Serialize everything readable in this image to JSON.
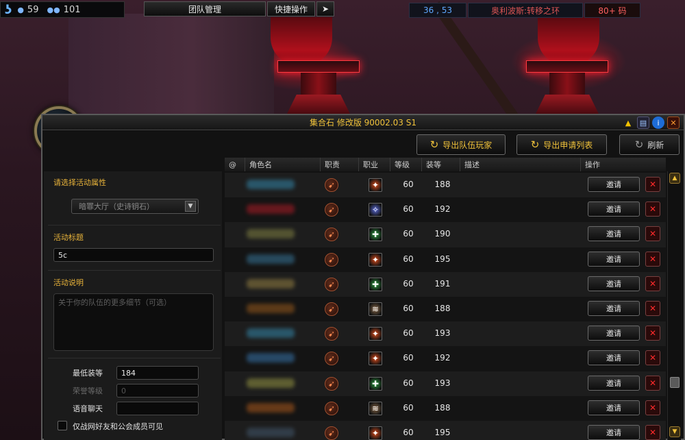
{
  "topbar": {
    "online_count": "59",
    "member_count": "101",
    "team_button": "团队管理",
    "quick_button": "快捷操作",
    "coords": "36 , 53",
    "zone": "奥利波斯:转移之环",
    "level_text": "80+ 码"
  },
  "window": {
    "title": "集合石 修改版 90002.03 S1",
    "export_team": "导出队伍玩家",
    "export_apply": "导出申请列表",
    "refresh": "刷新"
  },
  "left": {
    "activity_attr_label": "请选择活动属性",
    "activity_select_value": "暗罪大厅（史诗钥石）",
    "activity_title_label": "活动标题",
    "activity_title_value": "5c",
    "activity_desc_label": "活动说明",
    "activity_desc_placeholder": "关于你的队伍的更多细节（可选）",
    "min_ilvl_label": "最低装等",
    "min_ilvl_value": "184",
    "honor_label": "荣誉等级",
    "honor_value": "0",
    "voice_label": "语音聊天",
    "voice_value": "",
    "friends_only_label": "仅战网好友和公会成员可见"
  },
  "table": {
    "headers": {
      "at": "@",
      "name": "角色名",
      "role": "职责",
      "class": "职业",
      "level": "等级",
      "ilvl": "装等",
      "desc": "描述",
      "action": "操作"
    },
    "invite_label": "邀请",
    "reject_label": "✕",
    "rows": [
      {
        "level": "60",
        "ilvl": "188",
        "class_icon": "fire-class-icon",
        "class_color": "#d84a1a",
        "name_color": "#2f6f8a"
      },
      {
        "level": "60",
        "ilvl": "192",
        "class_icon": "frost-class-icon",
        "class_color": "#5a6ad8",
        "name_color": "#8a1a22"
      },
      {
        "level": "60",
        "ilvl": "190",
        "class_icon": "nature-class-icon",
        "class_color": "#2aa040",
        "name_color": "#6a6a3a"
      },
      {
        "level": "60",
        "ilvl": "195",
        "class_icon": "fire-class-icon",
        "class_color": "#d84a1a",
        "name_color": "#2f5f7a"
      },
      {
        "level": "60",
        "ilvl": "191",
        "class_icon": "nature-class-icon",
        "class_color": "#2aa040",
        "name_color": "#7a6a3a"
      },
      {
        "level": "60",
        "ilvl": "188",
        "class_icon": "claw-class-icon",
        "class_color": "#8a6a4a",
        "name_color": "#7a4a1a"
      },
      {
        "level": "60",
        "ilvl": "193",
        "class_icon": "fire-class-icon",
        "class_color": "#d84a1a",
        "name_color": "#2f6f8a"
      },
      {
        "level": "60",
        "ilvl": "192",
        "class_icon": "fire-class-icon",
        "class_color": "#d84a1a",
        "name_color": "#2f5f8a"
      },
      {
        "level": "60",
        "ilvl": "193",
        "class_icon": "nature-class-icon",
        "class_color": "#2aa040",
        "name_color": "#7a7a3a"
      },
      {
        "level": "60",
        "ilvl": "188",
        "class_icon": "claw-class-icon",
        "class_color": "#8a6a4a",
        "name_color": "#8a4a1a"
      },
      {
        "level": "60",
        "ilvl": "195",
        "class_icon": "fire-class-icon",
        "class_color": "#d84a1a",
        "name_color": "#3a4a5a"
      }
    ]
  }
}
